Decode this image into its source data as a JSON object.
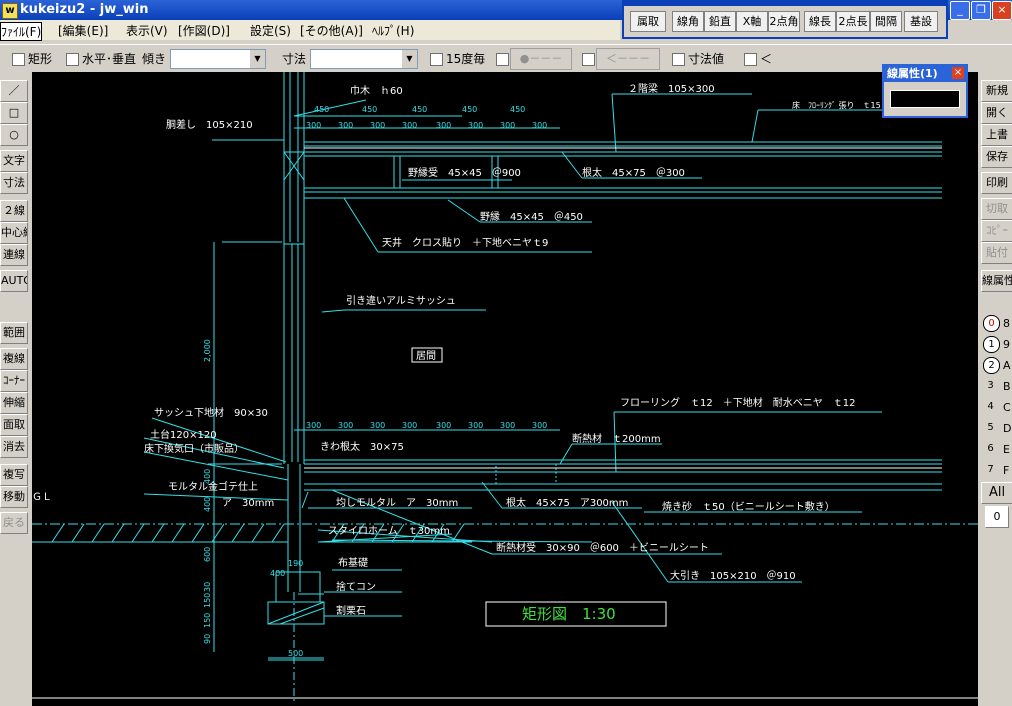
{
  "window": {
    "title": "kukeizu2 - jw_win",
    "app_icon": "w"
  },
  "menu": [
    "ﾌｧｲﾙ(F)",
    "[編集(E)]",
    "表示(V)",
    "[作図(D)]",
    "設定(S)",
    "[その他(A)]",
    "ﾍﾙﾌﾟ(H)"
  ],
  "float_toolbar": {
    "buttons": [
      "属取",
      "線角",
      "鉛直",
      "X軸",
      "2点角",
      "線長",
      "2点長",
      "間隔",
      "基設"
    ]
  },
  "options": {
    "rect_label": "矩形",
    "hv_label": "水平･垂直",
    "tilt_label": "傾き",
    "dim_label": "寸法",
    "deg15_label": "15度毎",
    "dis1": "●－－－",
    "dis2": "＜－－－",
    "dimval_label": "寸法値",
    "lt_label": "＜"
  },
  "left_tools": [
    "／",
    "□",
    "○",
    "文字",
    "寸法",
    "２線",
    "中心線",
    "連線",
    "AUTO",
    "範囲",
    "複線",
    "ｺｰﾅｰ",
    "伸縮",
    "面取",
    "消去",
    "複写",
    "移動",
    "戻る"
  ],
  "right_tools": [
    "新規",
    "開く",
    "上書",
    "保存",
    "印刷",
    "切取",
    "ｺﾋﾟｰ",
    "貼付",
    "線属性"
  ],
  "layers": [
    {
      "n": "0",
      "l": "8"
    },
    {
      "n": "1",
      "l": "9"
    },
    {
      "n": "2",
      "l": "A"
    },
    {
      "n": "3",
      "l": "B"
    },
    {
      "n": "4",
      "l": "C"
    },
    {
      "n": "5",
      "l": "D"
    },
    {
      "n": "6",
      "l": "E"
    },
    {
      "n": "7",
      "l": "F"
    }
  ],
  "layer_all": "All",
  "layer_zero": "0",
  "line_props": {
    "title": "線属性(1)",
    "close": "×"
  },
  "drawing": {
    "title": "矩形図　1:30",
    "room": "居間",
    "gl": "ＧＬ",
    "labels": {
      "l1": "巾木　ｈ60",
      "l2": "２階梁　105×300",
      "l3": "床　ﾌﾛｰﾘﾝｸﾞ 張り　ｔ15",
      "l4": "胴差し　105×210",
      "l5": "野縁受　45×45　＠900",
      "l6": "根太　45×75　＠300",
      "l7": "野縁　45×45　＠450",
      "l8": "天井　クロス貼り　＋下地ベニヤｔ9",
      "l9": "引き違いアルミサッシュ",
      "l10": "フローリング　ｔ12　＋下地材　耐水ベニヤ　ｔ12",
      "l11": "サッシュ下地材　90×30",
      "l12": "土台120×120",
      "l13": "床下換気口（市販品）",
      "l14": "きわ根太　30×75",
      "l15": "断熱材　ｔ200mm",
      "l16": "モルタル金ゴテ仕上",
      "l17": "ア　30mm",
      "l18": "均しモルタル　ア　30mm",
      "l19": "根太　45×75　ア300mm",
      "l20": "焼き砂　ｔ50（ビニールシート敷き）",
      "l21": "スタイロホーム　ｔ30mm",
      "l22": "断熱材受　30×90　＠600　＋ビニールシート",
      "l23": "布基礎",
      "l24": "大引き　105×210　＠910",
      "l25": "捨てコン",
      "l26": "割栗石"
    },
    "dim_top1": [
      "450",
      "450",
      "450",
      "450",
      "450"
    ],
    "dim_top2": [
      "300",
      "300",
      "300",
      "300",
      "300",
      "300",
      "300",
      "300"
    ],
    "dim_mid": [
      "300",
      "300",
      "300",
      "300",
      "300",
      "300",
      "300",
      "300"
    ],
    "dim_vert": [
      "2,000",
      "400",
      "400",
      "600",
      "30",
      "150",
      "150",
      "90"
    ],
    "dim_foot": [
      "400",
      "190",
      "500"
    ]
  },
  "colors": {
    "cyan": "#33e0e8",
    "white": "#ffffff",
    "green": "#40e040",
    "canvas": "#000000"
  }
}
